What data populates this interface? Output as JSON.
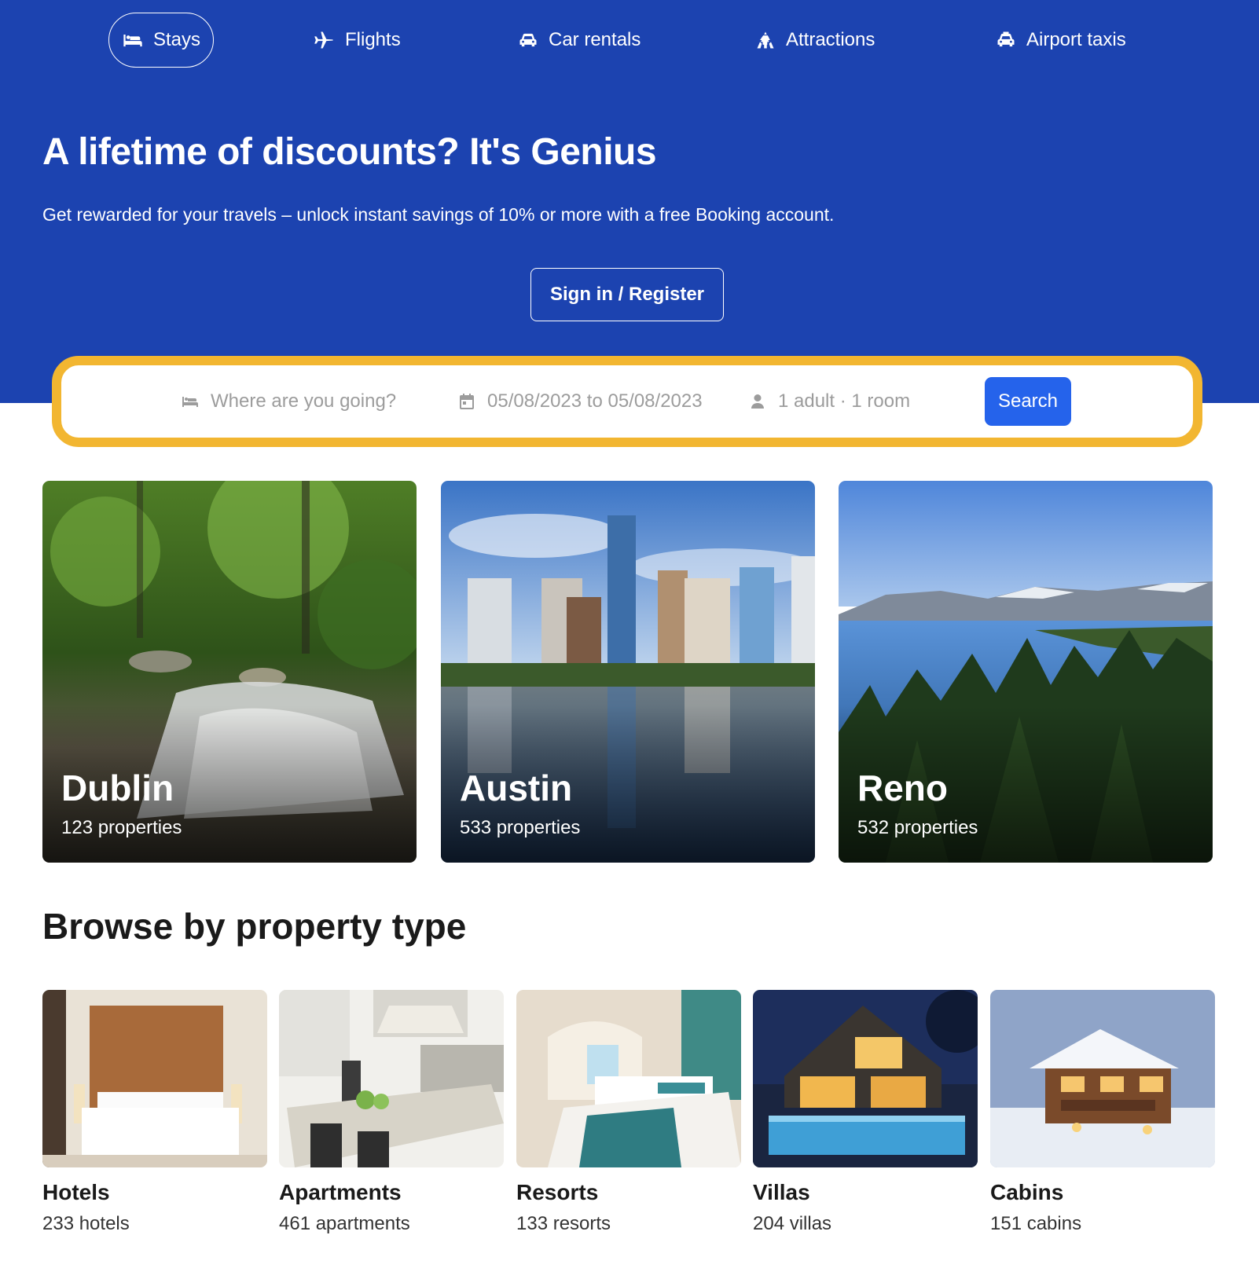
{
  "nav": {
    "items": [
      {
        "label": "Stays",
        "icon": "bed-icon",
        "active": true
      },
      {
        "label": "Flights",
        "icon": "plane-icon",
        "active": false
      },
      {
        "label": "Car rentals",
        "icon": "car-icon",
        "active": false
      },
      {
        "label": "Attractions",
        "icon": "attractions-icon",
        "active": false
      },
      {
        "label": "Airport taxis",
        "icon": "taxi-icon",
        "active": false
      }
    ]
  },
  "hero": {
    "title": "A lifetime of discounts? It's Genius",
    "subtitle": "Get rewarded for your travels – unlock instant savings of 10% or more with a free Booking account.",
    "signin_label": "Sign in / Register"
  },
  "search": {
    "destination_placeholder": "Where are you going?",
    "dates": "05/08/2023 to 05/08/2023",
    "guests": "1 adult · 1 room",
    "button_label": "Search"
  },
  "cities": [
    {
      "name": "Dublin",
      "count": "123 properties"
    },
    {
      "name": "Austin",
      "count": "533 properties"
    },
    {
      "name": "Reno",
      "count": "532 properties"
    }
  ],
  "browse": {
    "title": "Browse by property type",
    "types": [
      {
        "name": "Hotels",
        "count": "233 hotels"
      },
      {
        "name": "Apartments",
        "count": "461 apartments"
      },
      {
        "name": "Resorts",
        "count": "133 resorts"
      },
      {
        "name": "Villas",
        "count": "204 villas"
      },
      {
        "name": "Cabins",
        "count": "151 cabins"
      }
    ]
  },
  "colors": {
    "hero_bg": "#1c43b0",
    "search_border": "#f2b631",
    "search_button": "#2563eb"
  }
}
